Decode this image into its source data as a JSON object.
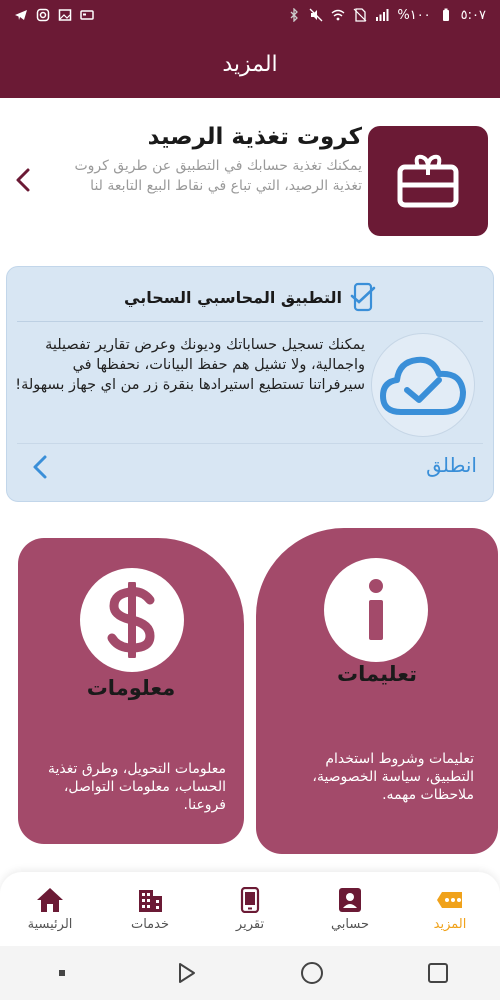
{
  "status_bar": {
    "time": "٥:٠٧",
    "battery": "%١٠٠"
  },
  "header": {
    "title": "المزيد"
  },
  "recharge_card": {
    "title": "كروت تغذية الرصيد",
    "description": "يمكنك تغذية حسابك في التطبيق عن طريق كروت تغذية الرصيد، التي تباع في نقاط البيع التابعة لنا"
  },
  "cloud_card": {
    "title": "التطبيق المحاسبي السحابي",
    "description": "يمكنك تسجيل حساباتك وديونك وعرض تقارير تفصيلية واجمالية، ولا تشيل هم حفظ البيانات، نحفظها في سيرفراتنا تستطيع استيرادها بنقرة زر من اي جهاز بسهولة!",
    "go_label": "انطلق"
  },
  "tiles": {
    "info": {
      "title": "معلومات",
      "description": "معلومات التحويل، وطرق تغذية الحساب، معلومات التواصل، فروعنا."
    },
    "instructions": {
      "title": "تعليمات",
      "description": "تعليمات وشروط استخدام التطبيق، سياسة الخصوصية، ملاحظات مهمه."
    }
  },
  "bottom_nav": {
    "items": [
      {
        "label": "المزيد",
        "icon": "more-icon",
        "active": true
      },
      {
        "label": "حسابي",
        "icon": "account-icon",
        "active": false
      },
      {
        "label": "تقرير",
        "icon": "report-icon",
        "active": false
      },
      {
        "label": "خدمات",
        "icon": "services-icon",
        "active": false
      },
      {
        "label": "الرئيسية",
        "icon": "home-icon",
        "active": false
      }
    ]
  },
  "colors": {
    "brand": "#6b1a35",
    "tile": "#a34a6a",
    "accent": "#f0a21b",
    "link": "#3a8fd8"
  }
}
